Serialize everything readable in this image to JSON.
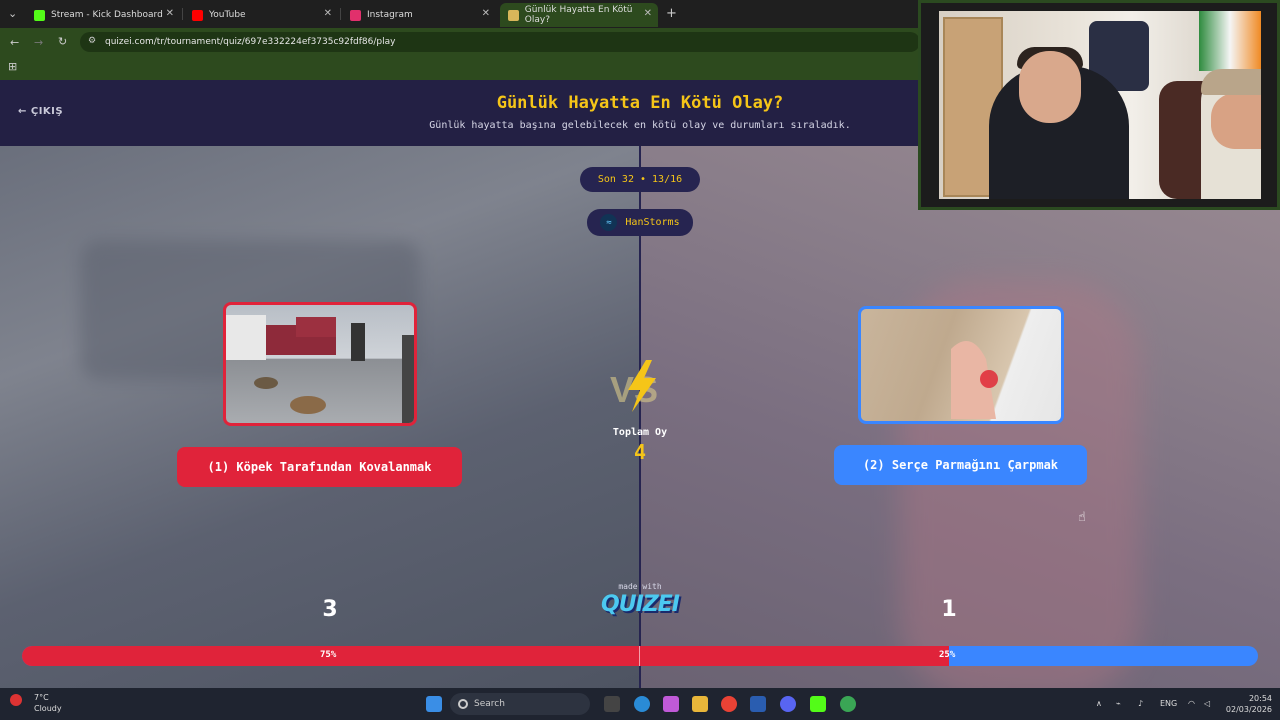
{
  "browser": {
    "tabs": [
      {
        "label": "Stream - Kick Dashboard",
        "icon": "kick-icon",
        "color": "#53fc18"
      },
      {
        "label": "YouTube",
        "icon": "youtube-icon",
        "color": "#ff0000"
      },
      {
        "label": "Instagram",
        "icon": "instagram-icon",
        "color": "#e1306c"
      },
      {
        "label": "Günlük Hayatta En Kötü Olay?",
        "icon": "quizei-icon",
        "color": "#d8b65a",
        "active": true
      }
    ],
    "new_tab": "+",
    "url": "quizei.com/tr/tournament/quiz/697e332224ef3735c92fdf86/play"
  },
  "header": {
    "exit_label": "ÇIKIŞ",
    "title": "Günlük Hayatta En Kötü Olay?",
    "subtitle": "Günlük hayatta başına gelebilecek en kötü olay ve durumları sıraladık."
  },
  "round": {
    "label": "Son 32 • 13/16"
  },
  "user": {
    "name": "HanStorms"
  },
  "matchup": {
    "left": {
      "label": "(1) Köpek Tarafından Kovalanmak",
      "votes": "3",
      "percent": "75%",
      "color": "#e0233a"
    },
    "right": {
      "label": "(2) Serçe Parmağını Çarpmak",
      "votes": "1",
      "percent": "25%",
      "color": "#3a86ff"
    },
    "vs": "VS",
    "total_label": "Toplam Oy",
    "total_value": "4",
    "left_fraction": 0.75
  },
  "footer": {
    "made_with": "made with",
    "brand": "QUIZEI"
  },
  "taskbar": {
    "weather_temp": "7°C",
    "weather_desc": "Cloudy",
    "search_placeholder": "Search",
    "lang": "ENG",
    "time": "20:54",
    "date": "02/03/2026"
  }
}
